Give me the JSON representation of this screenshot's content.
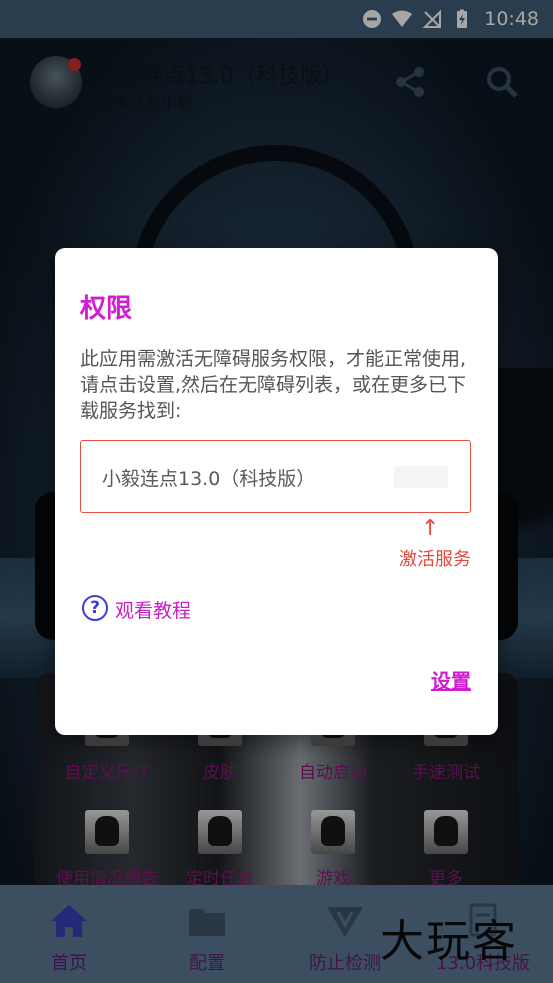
{
  "status_bar": {
    "time": "10:48"
  },
  "header": {
    "app_title": "小毅连点13.0（科技版）",
    "subtitle": "快手认准小毅"
  },
  "features": {
    "row1": [
      "自定义尺寸",
      "皮肤",
      "自动启动",
      "手速测试"
    ],
    "row2": [
      "使用情况报告",
      "定时任务",
      "游戏",
      "更多"
    ]
  },
  "bottom_nav": {
    "items": [
      {
        "label": "首页",
        "icon": "home-icon"
      },
      {
        "label": "配置",
        "icon": "folder-icon"
      },
      {
        "label": "防止检测",
        "icon": "shield-v-icon"
      },
      {
        "label": "13.0科技版",
        "icon": "info-icon"
      }
    ]
  },
  "watermark": "大玩客",
  "dialog": {
    "title": "权限",
    "message": "此应用需激活无障碍服务权限，才能正常使用,请点击设置,然后在无障碍列表，或在更多已下载服务找到:",
    "service_name": "小毅连点13.0（科技版）",
    "arrow": "↑",
    "activate_label": "激活服务",
    "help_icon_glyph": "?",
    "help_link": "观看教程",
    "settings_button": "设置"
  },
  "colors": {
    "accent_magenta": "#d21bd2",
    "highlight_red": "#e04a3c",
    "help_blue": "#3a3fd8",
    "nav_bar": "#5b7a94",
    "status_bar": "#3f5f79"
  }
}
